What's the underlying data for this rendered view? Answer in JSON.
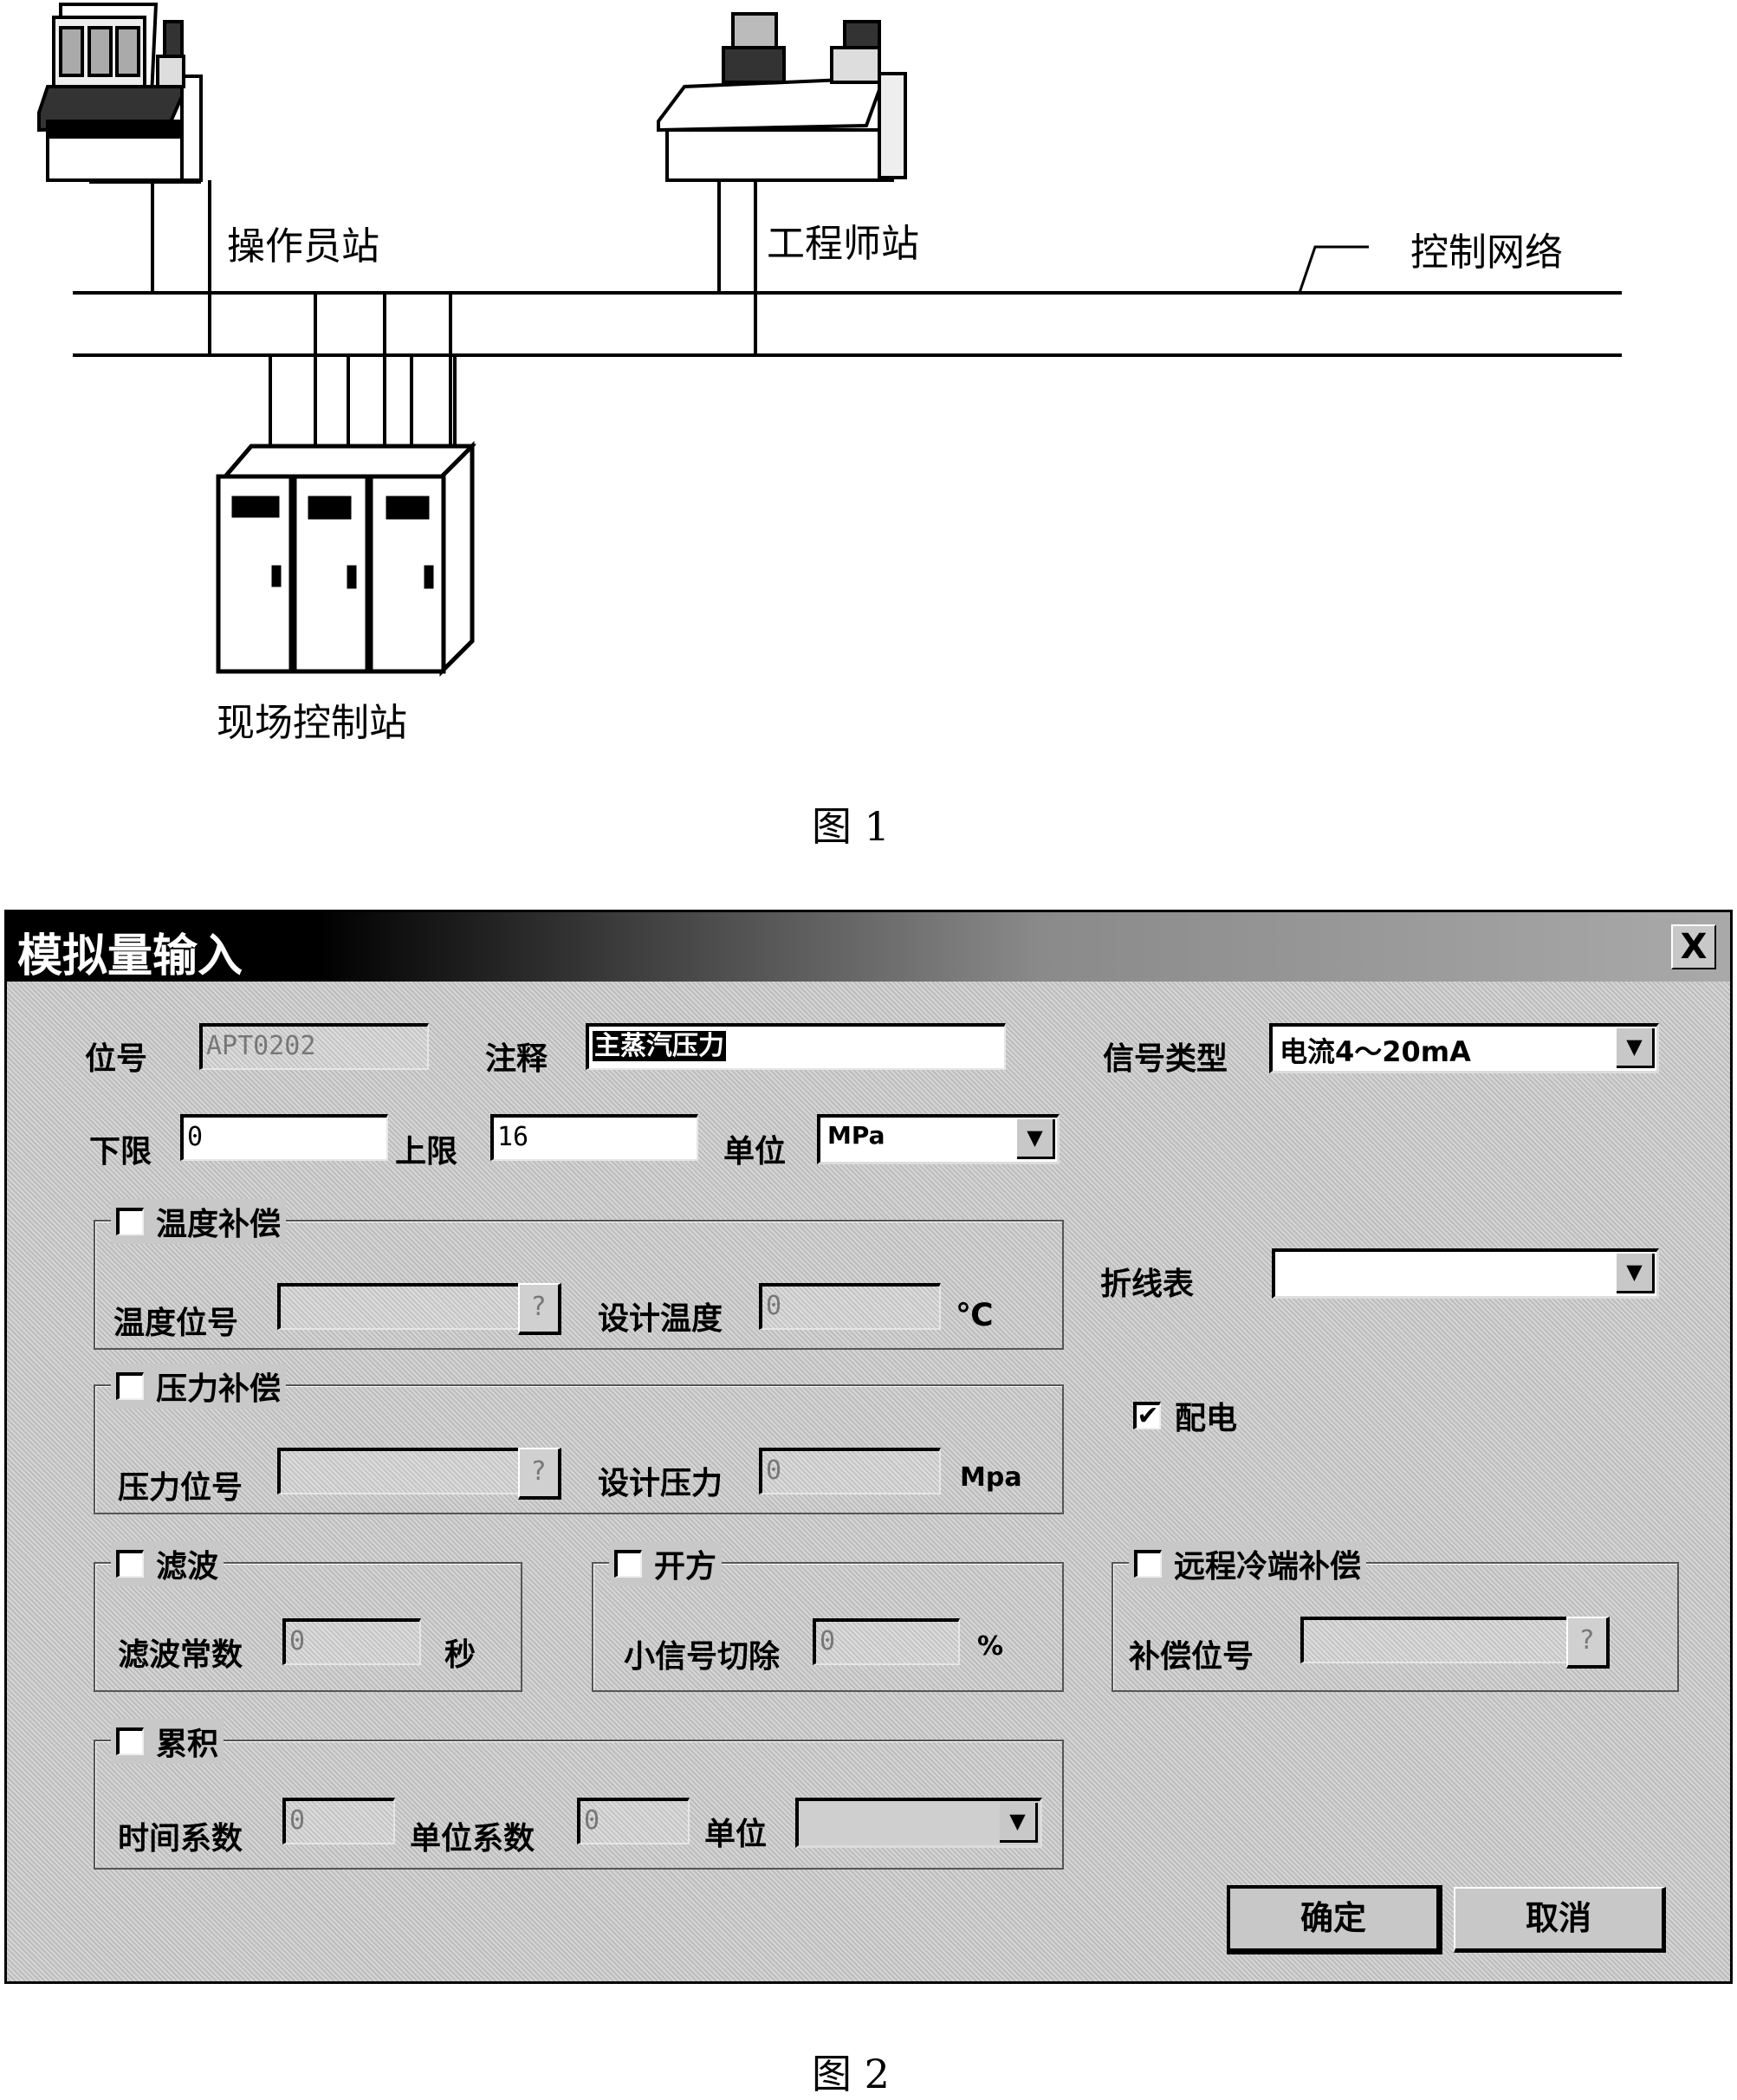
{
  "figure1": {
    "labels": {
      "operator_station": "操作员站",
      "engineer_station": "工程师站",
      "control_network": "控制网络",
      "field_control_station": "现场控制站"
    },
    "caption": "图 1"
  },
  "figure2": {
    "caption": "图 2",
    "dialog": {
      "title": "模拟量输入",
      "close_label": "X",
      "tag": {
        "label": "位号",
        "value": "APT0202"
      },
      "comment": {
        "label": "注释",
        "value": "主蒸汽压力"
      },
      "signal_type": {
        "label": "信号类型",
        "value": "电流4～20mA"
      },
      "lower_limit": {
        "label": "下限",
        "value": "0"
      },
      "upper_limit": {
        "label": "上限",
        "value": "16"
      },
      "unit": {
        "label": "单位",
        "value": "MPa"
      },
      "temp_comp": {
        "label": "温度补偿",
        "checked": false,
        "tag_label": "温度位号",
        "tag_value": "",
        "query_label": "?",
        "design_label": "设计温度",
        "design_value": "0",
        "design_unit": "℃"
      },
      "press_comp": {
        "label": "压力补偿",
        "checked": false,
        "tag_label": "压力位号",
        "tag_value": "",
        "query_label": "?",
        "design_label": "设计压力",
        "design_value": "0",
        "design_unit": "Mpa"
      },
      "polyline": {
        "label": "折线表",
        "value": ""
      },
      "power": {
        "label": "配电",
        "checked": true,
        "check_glyph": "✔"
      },
      "filter": {
        "label": "滤波",
        "checked": false,
        "const_label": "滤波常数",
        "const_value": "0",
        "unit": "秒"
      },
      "sqrt": {
        "label": "开方",
        "checked": false,
        "cutoff_label": "小信号切除",
        "cutoff_value": "0",
        "unit": "%"
      },
      "cold_junction": {
        "label": "远程冷端补偿",
        "checked": false,
        "tag_label": "补偿位号",
        "tag_value": "",
        "query_label": "?"
      },
      "accumulate": {
        "label": "累积",
        "checked": false,
        "time_label": "时间系数",
        "time_value": "0",
        "unit_coef_label": "单位系数",
        "unit_coef_value": "0",
        "unit_label": "单位",
        "unit_value": ""
      },
      "ok_label": "确定",
      "cancel_label": "取消",
      "dropdown_glyph": "▼"
    }
  }
}
